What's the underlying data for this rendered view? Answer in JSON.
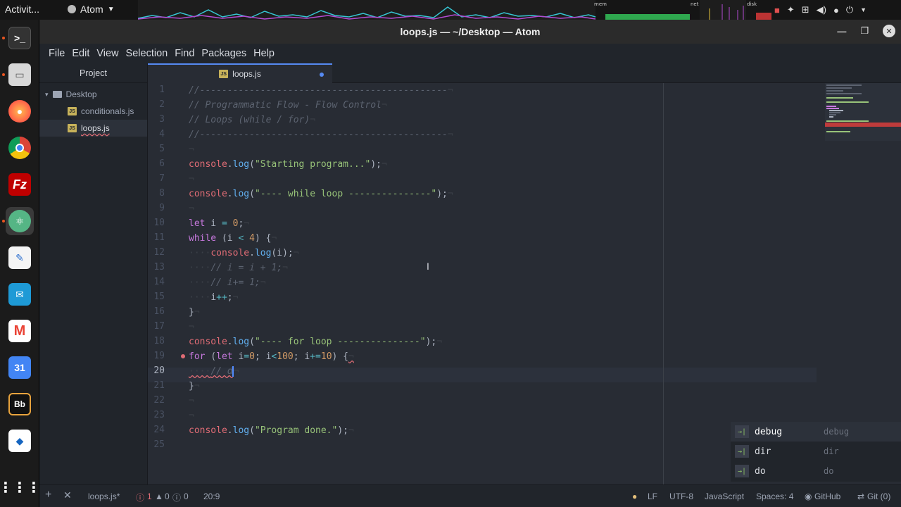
{
  "topbar": {
    "activities": "Activit...",
    "app_name": "Atom"
  },
  "window": {
    "title": "loops.js — ~/Desktop — Atom"
  },
  "menu": [
    "File",
    "Edit",
    "View",
    "Selection",
    "Find",
    "Packages",
    "Help"
  ],
  "tree": {
    "header": "Project",
    "root": "Desktop",
    "files": [
      "conditionals.js",
      "loops.js"
    ]
  },
  "tab": {
    "label": "loops.js"
  },
  "line_numbers": [
    "1",
    "2",
    "3",
    "4",
    "5",
    "6",
    "7",
    "8",
    "9",
    "10",
    "11",
    "12",
    "13",
    "14",
    "15",
    "16",
    "17",
    "18",
    "19",
    "20",
    "21",
    "22",
    "23",
    "24",
    "25"
  ],
  "autocomplete": [
    {
      "text": "debug",
      "type": "debug"
    },
    {
      "text": "dir",
      "type": "dir"
    },
    {
      "text": "do",
      "type": "do"
    }
  ],
  "status": {
    "file": "loops.js*",
    "errors": "1",
    "warnings": "0",
    "infos": "0",
    "cursor": "20:9",
    "line_ending": "LF",
    "encoding": "UTF-8",
    "grammar": "JavaScript",
    "indent": "Spaces: 4",
    "github": "GitHub",
    "git": "Git (0)"
  },
  "tray": {
    "mem": "mem",
    "net": "net",
    "disk": "disk"
  },
  "colors": {
    "accent": "#568af2",
    "error": "#e06c75",
    "bg": "#282c34"
  }
}
